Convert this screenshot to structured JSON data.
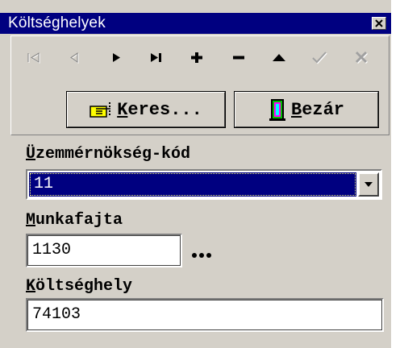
{
  "window": {
    "title": "Költséghelyek"
  },
  "navigator": {
    "buttons": [
      {
        "name": "first-record",
        "icon": "first-icon",
        "enabled": false
      },
      {
        "name": "prior-record",
        "icon": "prior-icon",
        "enabled": false
      },
      {
        "name": "next-record",
        "icon": "next-icon",
        "enabled": true
      },
      {
        "name": "last-record",
        "icon": "last-icon",
        "enabled": true
      },
      {
        "name": "insert-record",
        "icon": "plus-icon",
        "enabled": true
      },
      {
        "name": "delete-record",
        "icon": "minus-icon",
        "enabled": true
      },
      {
        "name": "edit-record",
        "icon": "up-triangle-icon",
        "enabled": true
      },
      {
        "name": "post-record",
        "icon": "check-icon",
        "enabled": false
      },
      {
        "name": "cancel-record",
        "icon": "x-icon",
        "enabled": false
      }
    ]
  },
  "buttons": {
    "search": {
      "accel": "K",
      "rest": "eres...",
      "icon": "pointing-hand-icon"
    },
    "close": {
      "accel": "B",
      "rest": "ezár",
      "icon": "door-exit-icon"
    }
  },
  "fields": {
    "unit_code": {
      "label_accel": "Ü",
      "label_rest": "zemmérnökség-kód",
      "value": "11"
    },
    "work_type": {
      "label_accel": "M",
      "label_rest": "unkafajta",
      "value": "1130"
    },
    "cost_center": {
      "label_accel": "K",
      "label_rest": "öltséghely",
      "value": "74103"
    }
  },
  "colors": {
    "titlebar": "#000080",
    "face": "#d4d0c8",
    "selection": "#000080"
  }
}
